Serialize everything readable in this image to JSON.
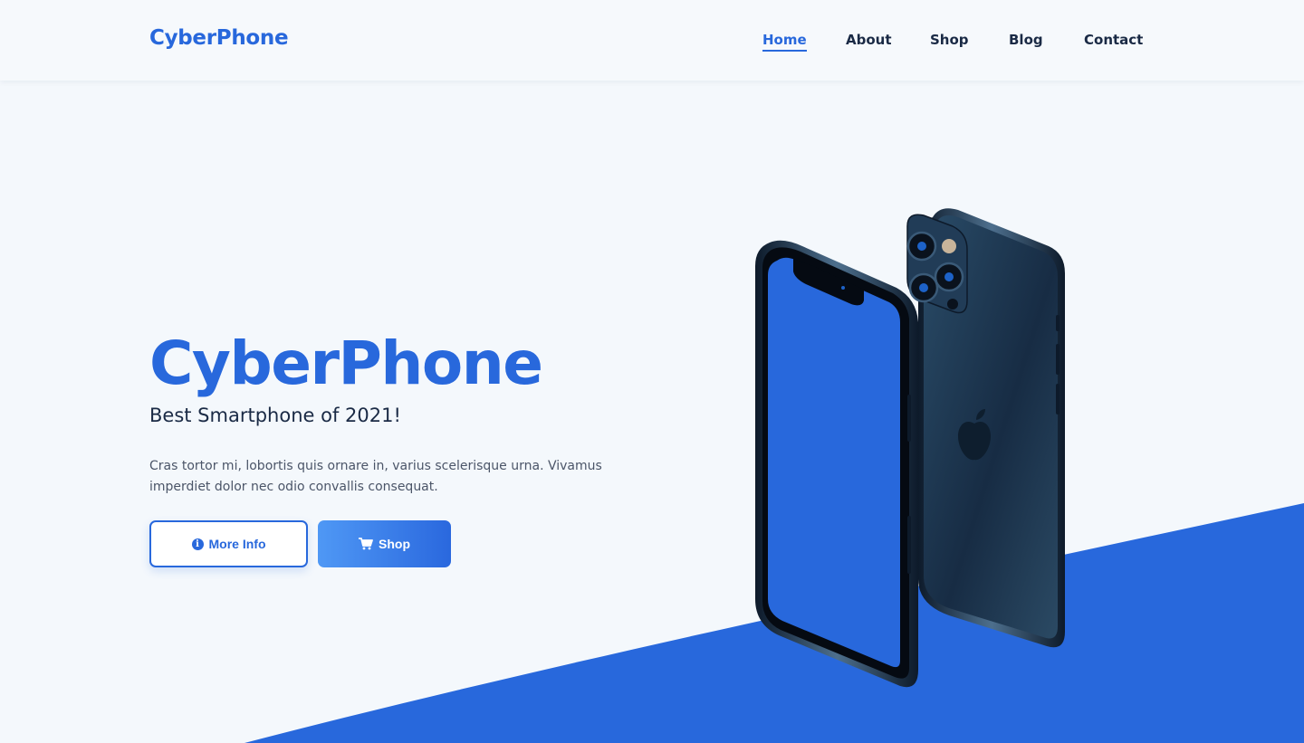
{
  "brand": {
    "name": "CyberPhone",
    "color": "#2868dc"
  },
  "nav": {
    "items": [
      {
        "label": "Home",
        "active": true
      },
      {
        "label": "About",
        "active": false
      },
      {
        "label": "Shop",
        "active": false
      },
      {
        "label": "Blog",
        "active": false
      },
      {
        "label": "Contact",
        "active": false
      }
    ]
  },
  "hero": {
    "title": "CyberPhone",
    "subtitle": "Best Smartphone of 2021!",
    "description": "Cras tortor mi, lobortis quis ornare in, varius scelerisque urna. Vivamus imperdiet dolor nec odio convallis consequat.",
    "buttons": {
      "info": {
        "label": "More Info",
        "icon": "info-circle-icon"
      },
      "shop": {
        "label": "Shop",
        "icon": "cart-icon"
      }
    }
  },
  "colors": {
    "accent": "#2868dc",
    "background": "#f4f8fc",
    "text_dark": "#1a2a45",
    "text_body": "#4b5568",
    "phone_screen": "#2868dc",
    "phone_body": "#1c3650"
  }
}
